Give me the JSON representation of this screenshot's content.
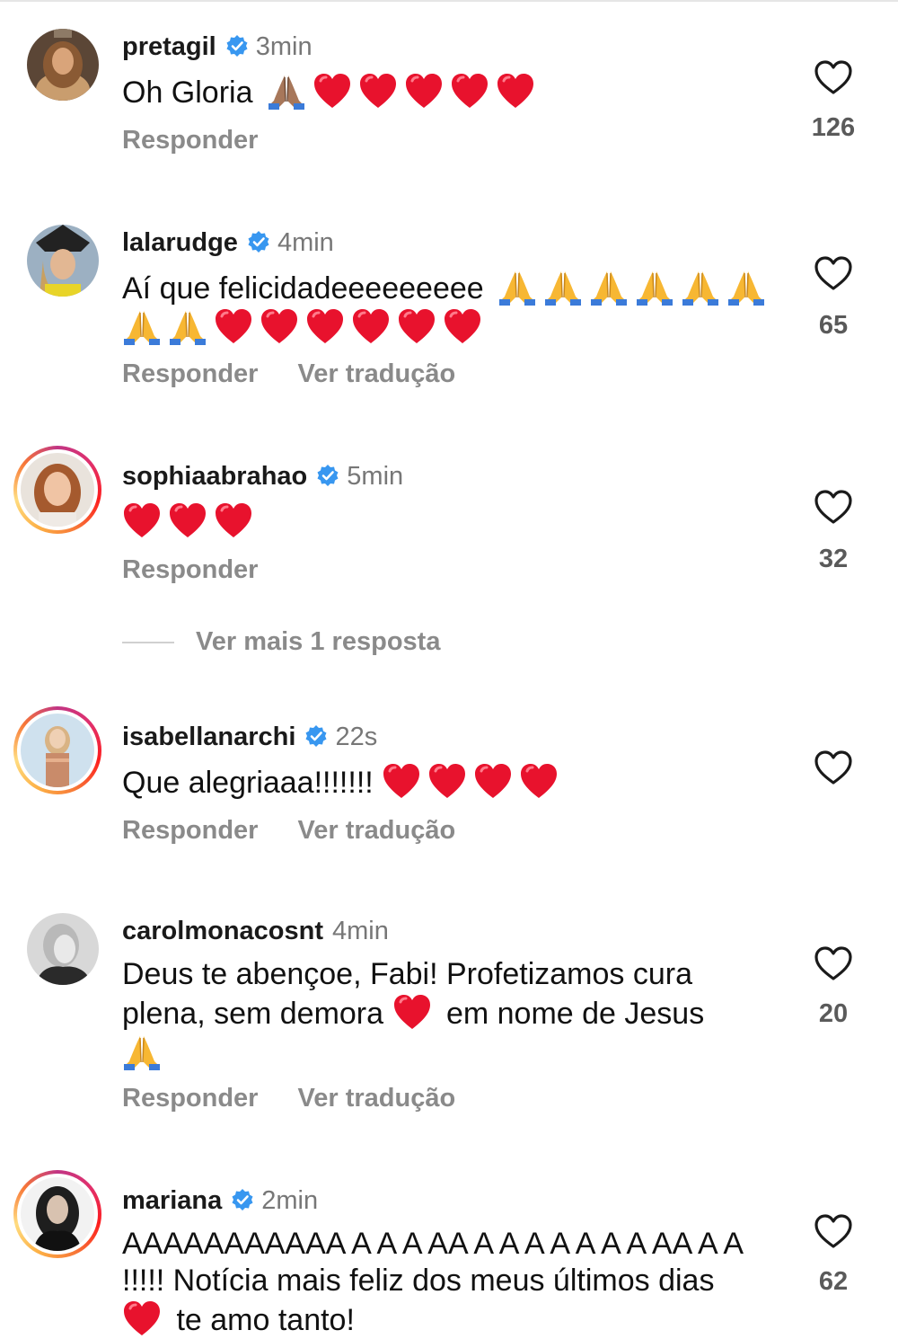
{
  "colors": {
    "verified": "#3897f0",
    "heart": "#e8122d",
    "muted": "#8a8a8a"
  },
  "icons": {
    "verified": "verified-badge-icon",
    "like": "heart-outline-icon",
    "heart": "red-heart-emoji",
    "pray": "folded-hands-emoji"
  },
  "comments": [
    {
      "username": "pretagil",
      "verified": true,
      "time": "3min",
      "text_parts": [
        "Oh Gloria",
        "🙏🏽❤️❤️❤️❤️❤️"
      ],
      "reply": "Responder",
      "translate": "",
      "likes": "126"
    },
    {
      "username": "lalarudge",
      "verified": true,
      "time": "4min",
      "text_parts": [
        "Aí que felicidadeeeeeeeee",
        "🙏🙏🙏🙏🙏🙏🙏🙏❤️❤️❤️❤️❤️❤️"
      ],
      "reply": "Responder",
      "translate": "Ver tradução",
      "likes": "65"
    },
    {
      "username": "sophiaabrahao",
      "verified": true,
      "time": "5min",
      "text_parts": [
        "",
        "❤️❤️❤️"
      ],
      "reply": "Responder",
      "translate": "",
      "likes": "32"
    },
    {
      "username": "isabellanarchi",
      "verified": true,
      "time": "22s",
      "text_parts": [
        "Que alegriaaa!!!!!!!",
        "❤️❤️❤️❤️"
      ],
      "reply": "Responder",
      "translate": "Ver tradução",
      "likes": ""
    },
    {
      "username": "carolmonacosnt",
      "verified": false,
      "time": "4min",
      "text_parts": [
        "Deus te abençoe, Fabi! Profetizamos cura plena, sem demora",
        "❤️",
        "em nome de Jesus",
        "🙏"
      ],
      "reply": "Responder",
      "translate": "Ver tradução",
      "likes": "20"
    },
    {
      "username": "mariana",
      "verified": true,
      "time": "2min",
      "text_parts": [
        "AAAAAAAAAAA A A A AA A A A A A A A AA A A !!!!! Notícia mais feliz dos meus últimos dias",
        "❤️",
        "te amo tanto!"
      ],
      "reply": "",
      "translate": "",
      "likes": "62"
    }
  ],
  "more_replies": "Ver mais 1 resposta"
}
